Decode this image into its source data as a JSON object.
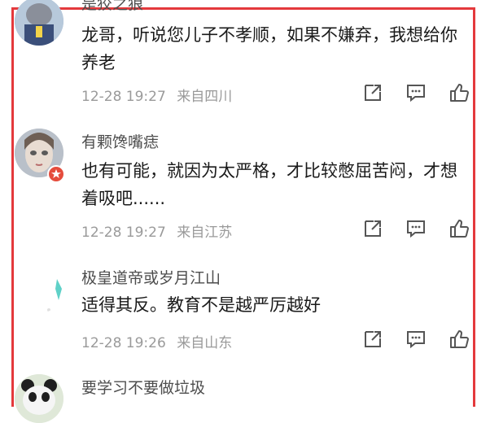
{
  "comments": [
    {
      "username": "是狡之狼",
      "text": "龙哥，听说您儿子不孝顺，如果不嫌弃，我想给你养老",
      "time": "12-28 19:27",
      "location": "来自四川"
    },
    {
      "username": "有颗馋嘴痣",
      "text": "也有可能，就因为太严格，才比较憋屈苦闷，才想着吸吧......",
      "time": "12-28 19:27",
      "location": "来自江苏"
    },
    {
      "username": "极皇道帝或岁月江山",
      "text": "适得其反。教育不是越严厉越好",
      "time": "12-28 19:26",
      "location": "来自山东"
    },
    {
      "username": "要学习不要做垃圾",
      "text": "",
      "time": "",
      "location": ""
    }
  ],
  "colors": {
    "frame": "#e4393c",
    "badge": "#e54c3c"
  },
  "icons": [
    "share-icon",
    "comment-icon",
    "like-icon",
    "avatar-badge-icon"
  ]
}
